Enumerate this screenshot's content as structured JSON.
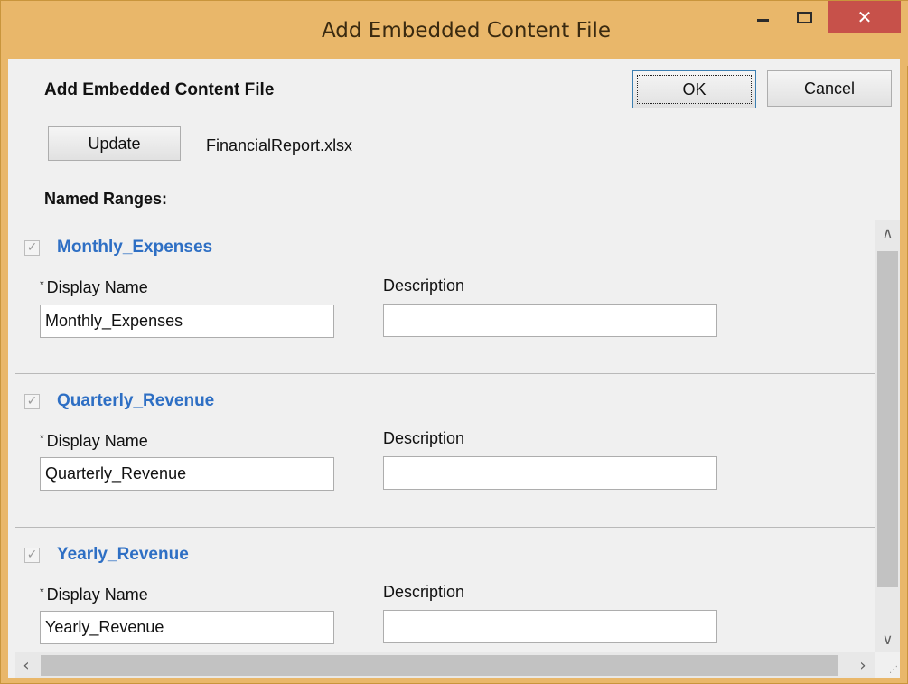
{
  "window": {
    "title": "Add Embedded Content File",
    "close_glyph": "✕"
  },
  "dialog": {
    "header": "Add Embedded Content File",
    "ok_label": "OK",
    "cancel_label": "Cancel",
    "update_label": "Update",
    "file_name": "FinancialReport.xlsx",
    "named_ranges_label": "Named Ranges:"
  },
  "ranges": [
    {
      "title": "Monthly_Expenses",
      "checked": true,
      "display_name_label": "Display Name",
      "display_name_value": "Monthly_Expenses",
      "description_label": "Description",
      "description_value": ""
    },
    {
      "title": "Quarterly_Revenue",
      "checked": true,
      "display_name_label": "Display Name",
      "display_name_value": "Quarterly_Revenue",
      "description_label": "Description",
      "description_value": ""
    },
    {
      "title": "Yearly_Revenue",
      "checked": true,
      "display_name_label": "Display Name",
      "display_name_value": "Yearly_Revenue",
      "description_label": "Description",
      "description_value": ""
    }
  ],
  "required_marker": "*",
  "colors": {
    "titlebar": "#e9b76a",
    "close_button": "#c7514a",
    "range_title": "#2e6fc4"
  }
}
